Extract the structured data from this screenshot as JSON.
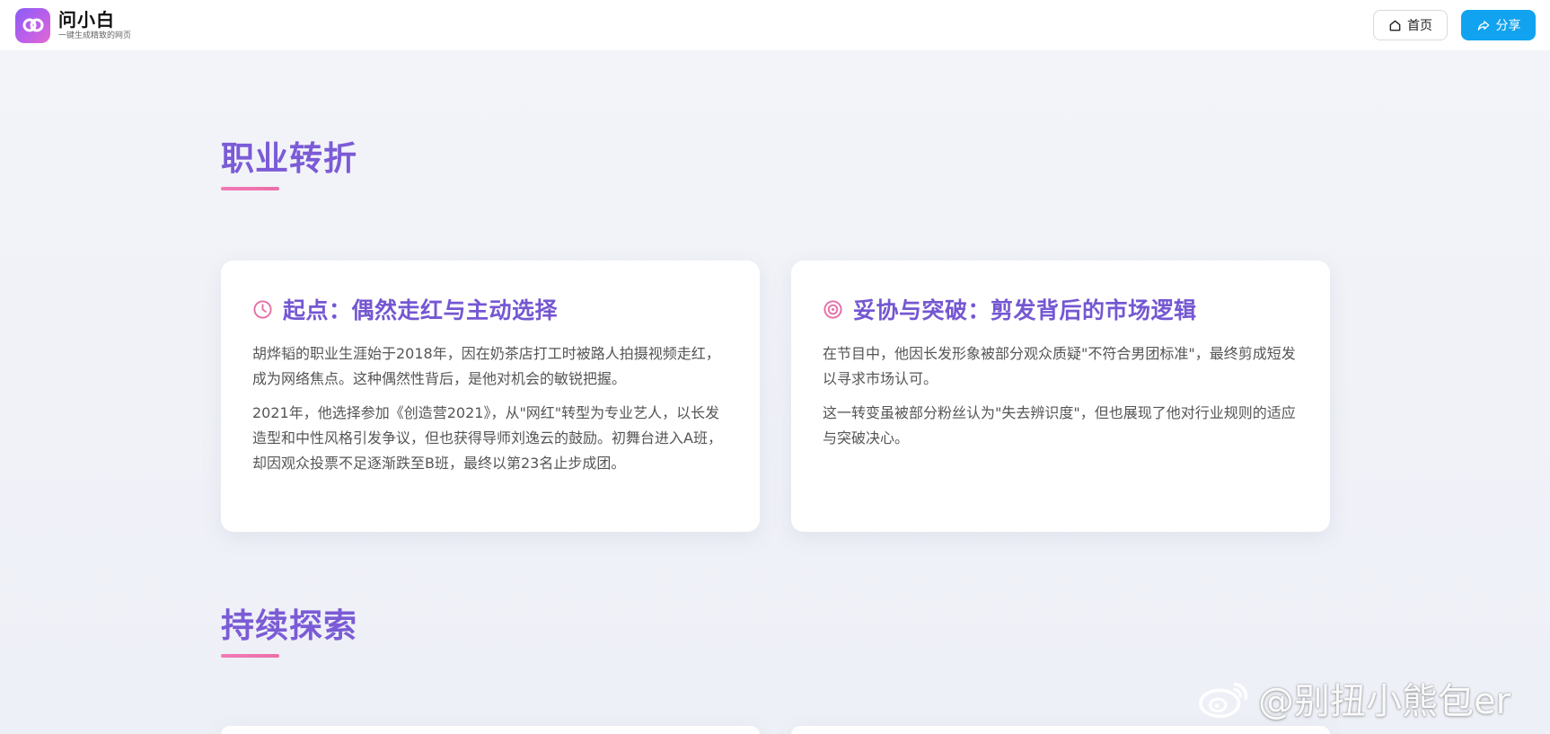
{
  "header": {
    "brand_name": "问小白",
    "brand_tagline": "一键生成精致的网页",
    "home_label": "首页",
    "share_label": "分享"
  },
  "sections": [
    {
      "title": "职业转折",
      "cards": [
        {
          "icon": "clock-icon",
          "title": "起点：偶然走红与主动选择",
          "paragraphs": [
            "胡烨韬的职业生涯始于2018年，因在奶茶店打工时被路人拍摄视频走红，成为网络焦点。这种偶然性背后，是他对机会的敏锐把握。",
            "2021年，他选择参加《创造营2021》，从\"网红\"转型为专业艺人，以长发造型和中性风格引发争议，但也获得导师刘逸云的鼓励。初舞台进入A班，却因观众投票不足逐渐跌至B班，最终以第23名止步成团。"
          ]
        },
        {
          "icon": "target-icon",
          "title": "妥协与突破：剪发背后的市场逻辑",
          "paragraphs": [
            "在节目中，他因长发形象被部分观众质疑\"不符合男团标准\"，最终剪成短发以寻求市场认可。",
            "这一转变虽被部分粉丝认为\"失去辨识度\"，但也展现了他对行业规则的适应与突破决心。"
          ]
        }
      ]
    },
    {
      "title": "持续探索",
      "cards": []
    }
  ],
  "watermark": "@别扭小熊包er",
  "colors": {
    "accent": "#7b5bd6",
    "underline": "#f07ab6",
    "icon": "#e66fa8",
    "share": "#11a3f0"
  }
}
